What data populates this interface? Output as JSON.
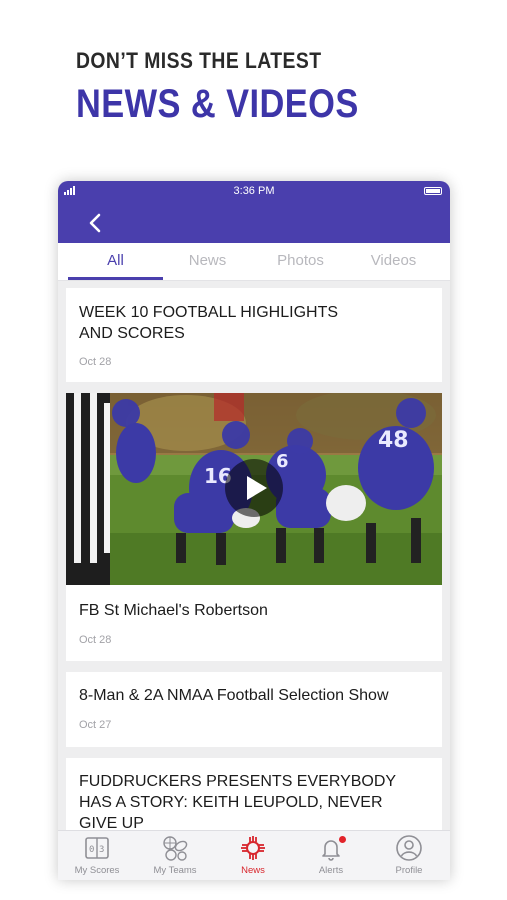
{
  "promo": {
    "line1": "DON’T MISS THE LATEST",
    "line2": "NEWS & VIDEOS"
  },
  "status_bar": {
    "time": "3:36 PM"
  },
  "nav": {
    "back_icon": "chevron-left-icon"
  },
  "tabs": [
    {
      "label": "All",
      "active": true
    },
    {
      "label": "News",
      "active": false
    },
    {
      "label": "Photos",
      "active": false
    },
    {
      "label": "Videos",
      "active": false
    }
  ],
  "feed": [
    {
      "title": "WEEK 10 FOOTBALL HIGHLIGHTS AND SCORES",
      "date": "Oct 28",
      "type": "article"
    },
    {
      "title": "FB St  Michael's Robertson",
      "date": "Oct 28",
      "type": "video"
    },
    {
      "title": "8-Man & 2A NMAA Football Selection Show",
      "date": "Oct 27",
      "type": "article"
    },
    {
      "title": "FUDDRUCKERS PRESENTS EVERYBODY HAS A STORY: KEITH LEUPOLD, NEVER GIVE UP",
      "date": "",
      "type": "article"
    }
  ],
  "bottom_tabs": [
    {
      "label": "My Scores",
      "icon": "scoreboard-icon",
      "active": false
    },
    {
      "label": "My Teams",
      "icon": "sports-balls-icon",
      "active": false
    },
    {
      "label": "News",
      "icon": "news-emblem-icon",
      "active": true
    },
    {
      "label": "Alerts",
      "icon": "bell-icon",
      "active": false,
      "badge": true
    },
    {
      "label": "Profile",
      "icon": "profile-icon",
      "active": false
    }
  ],
  "colors": {
    "brand_purple": "#4a3fad",
    "accent_red": "#d8262d",
    "background": "#eeeeef"
  }
}
